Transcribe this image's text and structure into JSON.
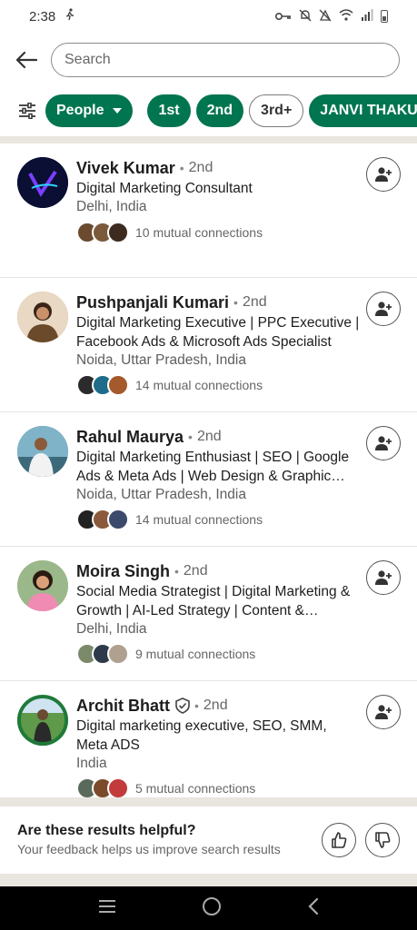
{
  "status": {
    "time": "2:38"
  },
  "search": {
    "placeholder": "Search"
  },
  "filters": [
    {
      "label": "People",
      "style": "green",
      "dropdown": true
    },
    {
      "label": "1st",
      "style": "green"
    },
    {
      "label": "2nd",
      "style": "green"
    },
    {
      "label": "3rd+",
      "style": "outline"
    },
    {
      "label": "JANVI THAKUR",
      "style": "green"
    }
  ],
  "results": [
    {
      "name": "Vivek Kumar",
      "degree": "2nd",
      "headline": "Digital Marketing Consultant",
      "location": "Delhi, India",
      "mutual": "10 mutual connections",
      "avatar_color": "#0a0f33",
      "face_colors": [
        "#6b4a2e",
        "#7a5a3a",
        "#3d2b1f"
      ]
    },
    {
      "name": "Pushpanjali Kumari",
      "degree": "2nd",
      "headline": "Digital Marketing Executive | PPC Executive | Facebook Ads & Microsoft Ads Specialist",
      "location": "Noida, Uttar Pradesh, India",
      "mutual": "14 mutual connections",
      "avatar_color": "#c9a27a",
      "face_colors": [
        "#2b2b2b",
        "#1f6b8a",
        "#a45a2a"
      ]
    },
    {
      "name": "Rahul Maurya",
      "degree": "2nd",
      "headline": "Digital Marketing Enthusiast | SEO | Google Ads & Meta Ads | Web Design & Graphic design",
      "location": "Noida, Uttar Pradesh, India",
      "mutual": "14 mutual connections",
      "avatar_color": "#4a8aa8",
      "face_colors": [
        "#222222",
        "#8a5a3a",
        "#3b4a6a"
      ]
    },
    {
      "name": "Moira Singh",
      "degree": "2nd",
      "headline": "Social Media Strategist | Digital Marketing & Growth | AI-Led Strategy | Content & Campaigns",
      "location": "Delhi, India",
      "mutual": "9 mutual connections",
      "avatar_color": "#e9a9c2",
      "face_colors": [
        "#7a8a6a",
        "#2e3a4a",
        "#b0a090"
      ]
    },
    {
      "name": "Archit Bhatt",
      "degree": "2nd",
      "verified": true,
      "headline": "Digital marketing executive, SEO,  SMM, Meta ADS",
      "location": "India",
      "mutual": "5 mutual connections",
      "avatar_color": "#5a8a4a",
      "face_colors": [
        "#5a6a5a",
        "#7a4a2a",
        "#c23a3a"
      ]
    }
  ],
  "feedback": {
    "title": "Are these results helpful?",
    "subtitle": "Your feedback helps us improve search results"
  }
}
